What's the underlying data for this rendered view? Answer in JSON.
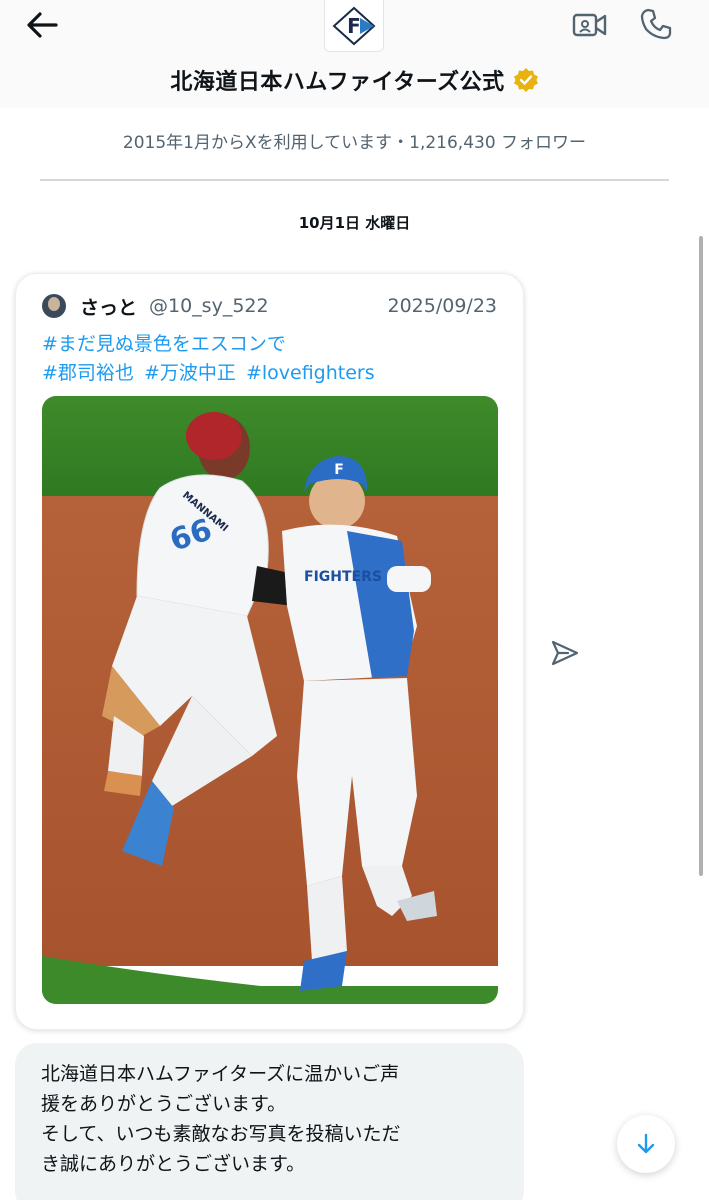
{
  "header": {
    "title": "北海道日本ハムファイターズ公式",
    "logo_letter": "F",
    "back_icon": "arrow-left-icon",
    "video_icon": "video-camera-icon",
    "call_icon": "phone-icon",
    "verified_icon": "verified-badge-icon",
    "verified_color": "#e8b20f"
  },
  "account_info": "2015年1月からXを利用しています・1,216,430 フォロワー",
  "date_separator": "10月1日 水曜日",
  "shared_post": {
    "author_name": "さっと",
    "author_handle": "@10_sy_522",
    "date": "2025/09/23",
    "hashtags_line1": [
      "#まだ見ぬ景色をエスコンで"
    ],
    "hashtags_line2": [
      "#郡司裕也",
      "#万波中正",
      "#lovefighters"
    ],
    "photo_icon": "photo-baseball-celebration",
    "photo_jersey_number": "66",
    "photo_back_name": "MANNAMI",
    "photo_chest_text": "FIGHTERS",
    "photo_helmet_letter": "F"
  },
  "reply_message": {
    "lines": [
      "北海道日本ハムファイターズに温かいご声",
      "援をありがとうございます。",
      "そして、いつも素敵なお写真を投稿いただ",
      "き誠にありがとうございます。"
    ]
  },
  "share_icon": "send-icon",
  "scroll_down_icon": "arrow-down-icon",
  "colors": {
    "link": "#1d9bf0",
    "secondary_text": "#536471",
    "bubble_bg": "#eff3f4"
  }
}
